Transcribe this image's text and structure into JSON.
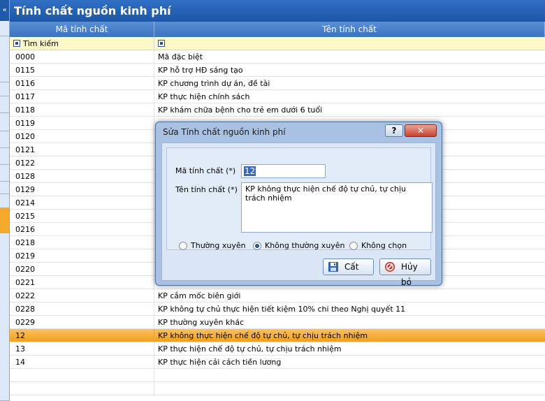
{
  "window": {
    "title": "Tính chất nguồn kinh phí",
    "collapse_glyph": "«"
  },
  "grid": {
    "columns": [
      "Mã tính chất",
      "Tên tính chất"
    ],
    "filter_label": "Tìm kiếm",
    "rows": [
      {
        "code": "0000",
        "name": "Mã đặc biệt"
      },
      {
        "code": "0115",
        "name": "KP hỗ trợ HĐ sáng tạo"
      },
      {
        "code": "0116",
        "name": "KP chương trình dự án, đề tài"
      },
      {
        "code": "0117",
        "name": "KP thực hiện chính sách"
      },
      {
        "code": "0118",
        "name": "KP khám chữa bệnh cho trẻ em dưới 6 tuổi"
      },
      {
        "code": "0119",
        "name": ""
      },
      {
        "code": "0120",
        "name": ""
      },
      {
        "code": "0121",
        "name": ""
      },
      {
        "code": "0122",
        "name": ""
      },
      {
        "code": "0128",
        "name": ""
      },
      {
        "code": "0129",
        "name": ""
      },
      {
        "code": "0214",
        "name": ""
      },
      {
        "code": "0215",
        "name": ""
      },
      {
        "code": "0216",
        "name": ""
      },
      {
        "code": "0218",
        "name": ""
      },
      {
        "code": "0219",
        "name": ""
      },
      {
        "code": "0220",
        "name": ""
      },
      {
        "code": "0221",
        "name": ""
      },
      {
        "code": "0222",
        "name": "KP cắm mốc biên giới"
      },
      {
        "code": "0228",
        "name": "KP không tự chủ thực hiện tiết kiệm 10% chi theo Nghị quyết 11"
      },
      {
        "code": "0229",
        "name": "KP thường xuyên khác"
      },
      {
        "code": "12",
        "name": "KP không thực hiện chế độ tự chủ, tự chịu trách nhiệm"
      },
      {
        "code": "13",
        "name": "KP thực hiện chế độ tự chủ, tự chịu trách nhiệm"
      },
      {
        "code": "14",
        "name": "KP thực hiện cải cách tiền lương"
      },
      {
        "code": "",
        "name": ""
      },
      {
        "code": "",
        "name": ""
      }
    ],
    "selected_index": 21
  },
  "dialog": {
    "title": "Sửa Tính chất nguồn kinh phí",
    "help_label": "?",
    "close_label": "✕",
    "code_label": "Mã tính chất (*)",
    "code_value": "12",
    "name_label": "Tên tính chất (*)",
    "name_value": "KP không thực hiện chế độ tự chủ, tự chịu trách nhiệm",
    "radios": {
      "regular": "Thường xuyên",
      "irregular": "Không thường xuyên",
      "none": "Không chọn",
      "selected": "irregular"
    },
    "save_label": "Cất",
    "cancel_label": "Hủy bỏ",
    "save_icon": "floppy-disk-icon",
    "cancel_icon": "cancel-circle-icon"
  },
  "colors": {
    "title_bar": "#1d56a6",
    "header": "#3a73c0",
    "selected_row": "#f2a020",
    "filter_row": "#fff8c8",
    "dialog_frame": "#a9c2e4"
  }
}
